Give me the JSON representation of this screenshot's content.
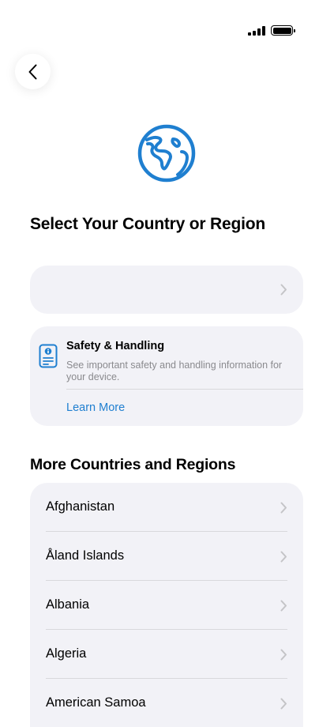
{
  "status_bar": {
    "signal_icon": "signal-bars-icon",
    "battery_icon": "battery-full-icon"
  },
  "nav": {
    "back_icon": "chevron-left-icon"
  },
  "header": {
    "icon": "globe-icon",
    "title": "Select Your Country or Region"
  },
  "country_select": {
    "value": "",
    "icon": "chevron-right-icon"
  },
  "safety": {
    "icon": "info-document-icon",
    "title": "Safety & Handling",
    "description": "See important safety and handling information for your device.",
    "link": "Learn More",
    "link_color": "#1f7fd0"
  },
  "more_section": {
    "title": "More Countries and Regions",
    "items": [
      {
        "label": "Afghanistan"
      },
      {
        "label": "Åland Islands"
      },
      {
        "label": "Albania"
      },
      {
        "label": "Algeria"
      },
      {
        "label": "American Samoa"
      }
    ]
  },
  "colors": {
    "accent": "#1f7fd0",
    "card_bg": "#f2f2f7",
    "chevron": "#c4c4c7"
  }
}
